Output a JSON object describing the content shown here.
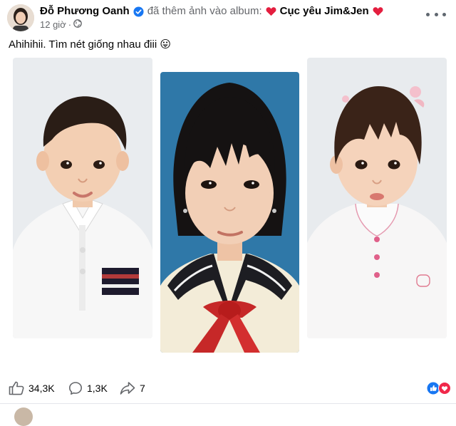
{
  "post": {
    "author": "Đỗ Phương Oanh",
    "action_text": "đã thêm ảnh vào album:",
    "album_name": "Cục yêu Jim&Jen",
    "time": "12 giờ",
    "privacy_icon": "globe-icon",
    "text": "Ahihihii. Tìm nét giống nhau điii",
    "emoji": "😛"
  },
  "photos": [
    {
      "name": "photo-baby-boy",
      "description_icon": "portrait"
    },
    {
      "name": "photo-girl-uniform",
      "description_icon": "portrait"
    },
    {
      "name": "photo-baby-girl",
      "description_icon": "portrait"
    }
  ],
  "stats": {
    "likes": "34,3K",
    "comments": "1,3K",
    "shares": "7"
  },
  "colors": {
    "link_blue": "#1877f2",
    "heart_red": "#e41e3f",
    "muted": "#65676b"
  }
}
